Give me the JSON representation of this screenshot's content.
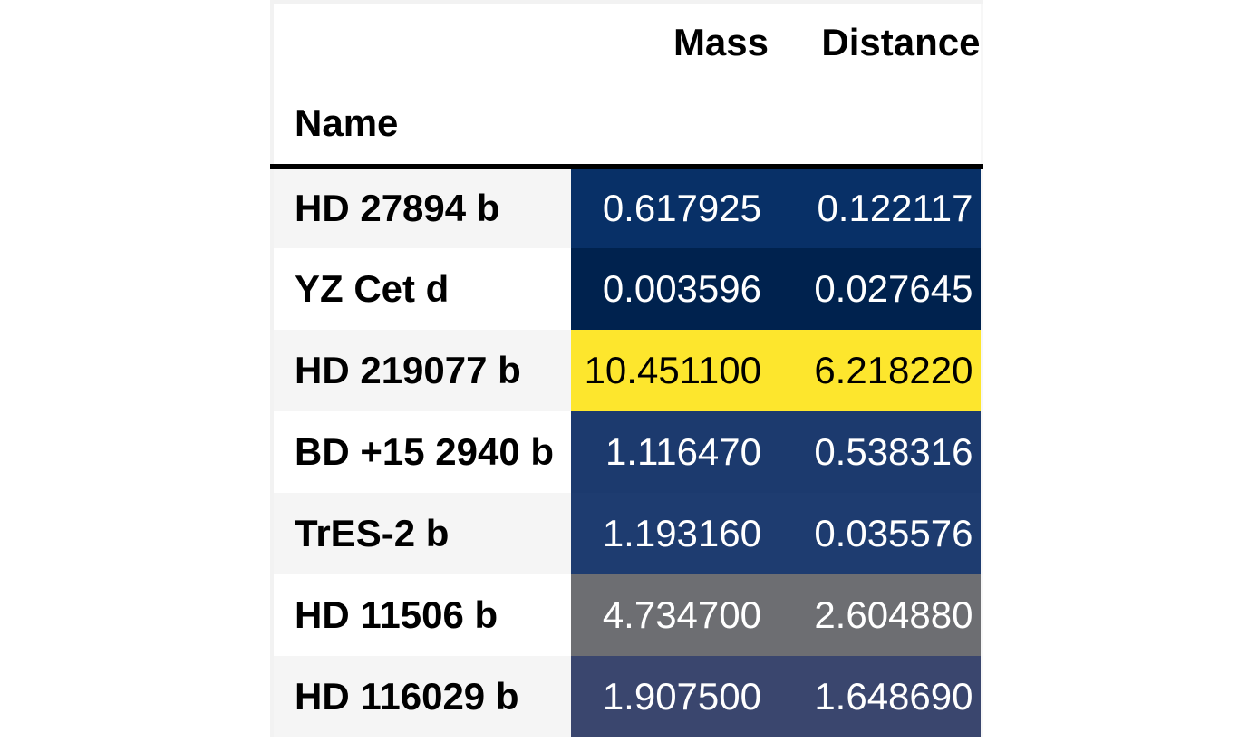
{
  "chart_data": {
    "type": "table",
    "title": "",
    "index_name": "Name",
    "columns": [
      "Mass",
      "Distance"
    ],
    "rows": [
      {
        "name": "HD 27894 b",
        "mass": "0.617925",
        "distance": "0.122117",
        "row_bg": "#083067",
        "row_fg": "#ffffff"
      },
      {
        "name": "YZ Cet d",
        "mass": "0.003596",
        "distance": "0.027645",
        "row_bg": "#00224e",
        "row_fg": "#ffffff"
      },
      {
        "name": "HD 219077 b",
        "mass": "10.451100",
        "distance": "6.218220",
        "row_bg": "#fde62d",
        "row_fg": "#000000"
      },
      {
        "name": "BD +15 2940 b",
        "mass": "1.116470",
        "distance": "0.538316",
        "row_bg": "#1c3a6e",
        "row_fg": "#ffffff"
      },
      {
        "name": "TrES-2 b",
        "mass": "1.193160",
        "distance": "0.035576",
        "row_bg": "#1e3c70",
        "row_fg": "#ffffff"
      },
      {
        "name": "HD 11506 b",
        "mass": "4.734700",
        "distance": "2.604880",
        "row_bg": "#6d6e72",
        "row_fg": "#ffffff"
      },
      {
        "name": "HD 116029 b",
        "mass": "1.907500",
        "distance": "1.648690",
        "row_bg": "#3a466e",
        "row_fg": "#ffffff"
      }
    ],
    "layout": {
      "stripe_color": "#f5f5f5",
      "header_border_color": "#000000",
      "gradient_palette": "cividis"
    }
  },
  "header": {
    "mass_label": "Mass",
    "distance_label": "Distance",
    "index_label": "Name"
  }
}
